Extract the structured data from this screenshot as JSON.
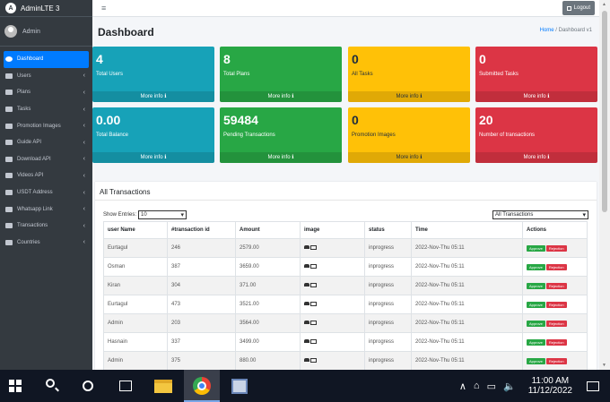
{
  "brand": {
    "title": "AdminLTE 3",
    "logo_letter": "A"
  },
  "user": {
    "name": "Admin"
  },
  "sidebar": {
    "items": [
      {
        "label": "Dashboard",
        "active": true
      },
      {
        "label": "Users",
        "chevron": "‹"
      },
      {
        "label": "Plans",
        "chevron": "‹"
      },
      {
        "label": "Tasks",
        "chevron": "‹"
      },
      {
        "label": "Promotion Images",
        "chevron": "‹"
      },
      {
        "label": "Guide API",
        "chevron": "‹"
      },
      {
        "label": "Download API",
        "chevron": "‹"
      },
      {
        "label": "Videos API",
        "chevron": "‹"
      },
      {
        "label": "USDT Address",
        "chevron": "‹"
      },
      {
        "label": "Whatsapp Link",
        "chevron": "‹"
      },
      {
        "label": "Transactions",
        "chevron": "‹"
      },
      {
        "label": "Countries",
        "chevron": "‹"
      }
    ]
  },
  "header": {
    "menu_icon": "≡",
    "logout_label": "Logout"
  },
  "page": {
    "title": "Dashboard",
    "breadcrumb_home": "Home",
    "breadcrumb_sep": "/",
    "breadcrumb_current": "Dashboard v1"
  },
  "stats": [
    {
      "value": "4",
      "label": "Total Users",
      "footer": "More info ℹ",
      "color": "#17a2b8"
    },
    {
      "value": "8",
      "label": "Total Plans",
      "footer": "More info ℹ",
      "color": "#28a745"
    },
    {
      "value": "0",
      "label": "All Tasks",
      "footer": "More info ℹ",
      "color": "#ffc107"
    },
    {
      "value": "0",
      "label": "Submitted Tasks",
      "footer": "More info ℹ",
      "color": "#dc3545"
    },
    {
      "value": "0.00",
      "label": "Total Balance",
      "footer": "More info ℹ",
      "color": "#17a2b8"
    },
    {
      "value": "59484",
      "label": "Pending Transactions",
      "footer": "More info ℹ",
      "color": "#28a745"
    },
    {
      "value": "0",
      "label": "Promotion Images",
      "footer": "More info ℹ",
      "color": "#ffc107"
    },
    {
      "value": "20",
      "label": "Number of transactions",
      "footer": "More info ℹ",
      "color": "#dc3545"
    }
  ],
  "transactions": {
    "title": "All Transactions",
    "show_entries_label": "Show Entries:",
    "show_entries_value": "10",
    "filter_value": "All Transactions",
    "columns": [
      "user Name",
      "#transaction id",
      "Amount",
      "image",
      "status",
      "Time",
      "Actions"
    ],
    "approve_label": "Approve",
    "reject_label": "Rejection",
    "rows": [
      {
        "user": "Eurtagul",
        "id": "246",
        "amount": "2579.00",
        "status": "inprogress",
        "time": "2022-Nov-Thu 05:11"
      },
      {
        "user": "Osman",
        "id": "387",
        "amount": "3659.00",
        "status": "inprogress",
        "time": "2022-Nov-Thu 05:11"
      },
      {
        "user": "Kiran",
        "id": "304",
        "amount": "371.00",
        "status": "inprogress",
        "time": "2022-Nov-Thu 05:11"
      },
      {
        "user": "Eurtagul",
        "id": "473",
        "amount": "3521.00",
        "status": "inprogress",
        "time": "2022-Nov-Thu 05:11"
      },
      {
        "user": "Admin",
        "id": "203",
        "amount": "3564.00",
        "status": "inprogress",
        "time": "2022-Nov-Thu 05:11"
      },
      {
        "user": "Hasnain",
        "id": "337",
        "amount": "3499.00",
        "status": "inprogress",
        "time": "2022-Nov-Thu 05:11"
      },
      {
        "user": "Admin",
        "id": "375",
        "amount": "880.00",
        "status": "inprogress",
        "time": "2022-Nov-Thu 05:11"
      }
    ]
  },
  "taskbar": {
    "time": "11:00 AM",
    "date": "11/12/2022",
    "tray_symbols": [
      "∧",
      "⌂",
      "▭",
      "🔈"
    ]
  }
}
